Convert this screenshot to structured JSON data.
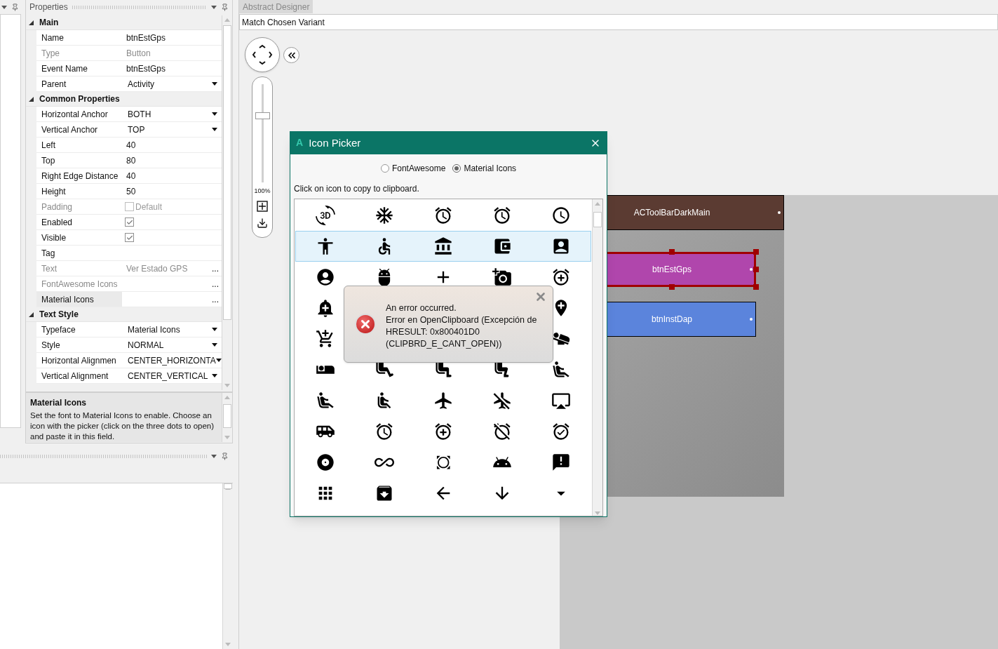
{
  "properties": {
    "title": "Properties",
    "sections": [
      {
        "title": "Main",
        "expanded": true,
        "rows": [
          {
            "label": "Name",
            "value": "btnEstGps",
            "kind": "text",
            "disabled": false,
            "selected": false
          },
          {
            "label": "Type",
            "value": "Button",
            "kind": "text",
            "disabled": true,
            "selected": false
          },
          {
            "label": "Event Name",
            "value": "btnEstGps",
            "kind": "text",
            "disabled": false,
            "selected": false
          },
          {
            "label": "Parent",
            "value": "Activity",
            "kind": "dropdown",
            "disabled": false,
            "selected": false
          }
        ]
      },
      {
        "title": "Common Properties",
        "expanded": true,
        "rows": [
          {
            "label": "Horizontal Anchor",
            "value": "BOTH",
            "kind": "dropdown",
            "disabled": false,
            "selected": false
          },
          {
            "label": "Vertical Anchor",
            "value": "TOP",
            "kind": "dropdown",
            "disabled": false,
            "selected": false
          },
          {
            "label": "Left",
            "value": "40",
            "kind": "text",
            "disabled": false,
            "selected": false
          },
          {
            "label": "Top",
            "value": "80",
            "kind": "text",
            "disabled": false,
            "selected": false
          },
          {
            "label": "Right Edge Distance",
            "value": "40",
            "kind": "text",
            "disabled": false,
            "selected": false
          },
          {
            "label": "Height",
            "value": "50",
            "kind": "text",
            "disabled": false,
            "selected": false
          },
          {
            "label": "Padding",
            "value": "Default",
            "kind": "checkbox",
            "checked": false,
            "disabled": true,
            "selected": false
          },
          {
            "label": "Enabled",
            "kind": "checkbox",
            "checked": true,
            "disabled": false,
            "selected": false
          },
          {
            "label": "Visible",
            "kind": "checkbox",
            "checked": true,
            "disabled": false,
            "selected": false
          },
          {
            "label": "Tag",
            "kind": "text",
            "disabled": false,
            "selected": false
          },
          {
            "label": "Text",
            "value": "Ver Estado GPS",
            "kind": "ellipsis",
            "action": "...",
            "disabled": true,
            "selected": false
          },
          {
            "label": "FontAwesome Icons",
            "kind": "ellipsis",
            "action": "...",
            "disabled": true,
            "selected": false
          },
          {
            "label": "Material Icons",
            "kind": "ellipsis",
            "action": "...",
            "disabled": false,
            "selected": true
          }
        ]
      },
      {
        "title": "Text Style",
        "expanded": true,
        "rows": [
          {
            "label": "Typeface",
            "value": "Material Icons",
            "kind": "dropdown",
            "disabled": false,
            "selected": false
          },
          {
            "label": "Style",
            "value": "NORMAL",
            "kind": "dropdown",
            "disabled": false,
            "selected": false
          },
          {
            "label": "Horizontal Alignmen",
            "value": "CENTER_HORIZONTA",
            "kind": "dropdown",
            "disabled": false,
            "selected": false
          },
          {
            "label": "Vertical Alignment",
            "value": "CENTER_VERTICAL",
            "kind": "dropdown",
            "disabled": false,
            "selected": false
          }
        ]
      }
    ],
    "description": {
      "title": "Material Icons",
      "text": "Set the font to Material Icons to enable. Choose an icon with the picker (click on the three dots to open) and paste it in this field."
    }
  },
  "designer": {
    "tab": "Abstract Designer",
    "variant": "Match Chosen Variant",
    "zoom": {
      "level": 0.69,
      "reading": "100%"
    },
    "views": [
      {
        "label": "ACToolBarDarkMain",
        "color": "#5b3b32",
        "selected": false,
        "kind": "bar"
      },
      {
        "label": "btnEstGps",
        "color": "#b046ac",
        "selected": true,
        "kind": "button"
      },
      {
        "label": "btnInstDap",
        "color": "#5b84dc",
        "selected": false,
        "kind": "button"
      }
    ]
  },
  "icon_picker": {
    "logo": "A",
    "title": "Icon Picker",
    "options": [
      {
        "label": "FontAwesome",
        "selected": false
      },
      {
        "label": "Material Icons",
        "selected": true
      }
    ],
    "hint": "Click on icon to copy to clipboard.",
    "rows": [
      {
        "selected": false
      },
      {
        "selected": true
      },
      {
        "selected": false
      },
      {
        "selected": false
      },
      {
        "selected": false
      },
      {
        "selected": false
      },
      {
        "selected": false
      },
      {
        "selected": false
      },
      {
        "selected": false
      },
      {
        "selected": false
      }
    ]
  },
  "error": {
    "title": "An error occurred.",
    "message": "Error en OpenClipboard (Excepción de HRESULT: 0x800401D0 (CLIPBRD_E_CANT_OPEN))"
  }
}
